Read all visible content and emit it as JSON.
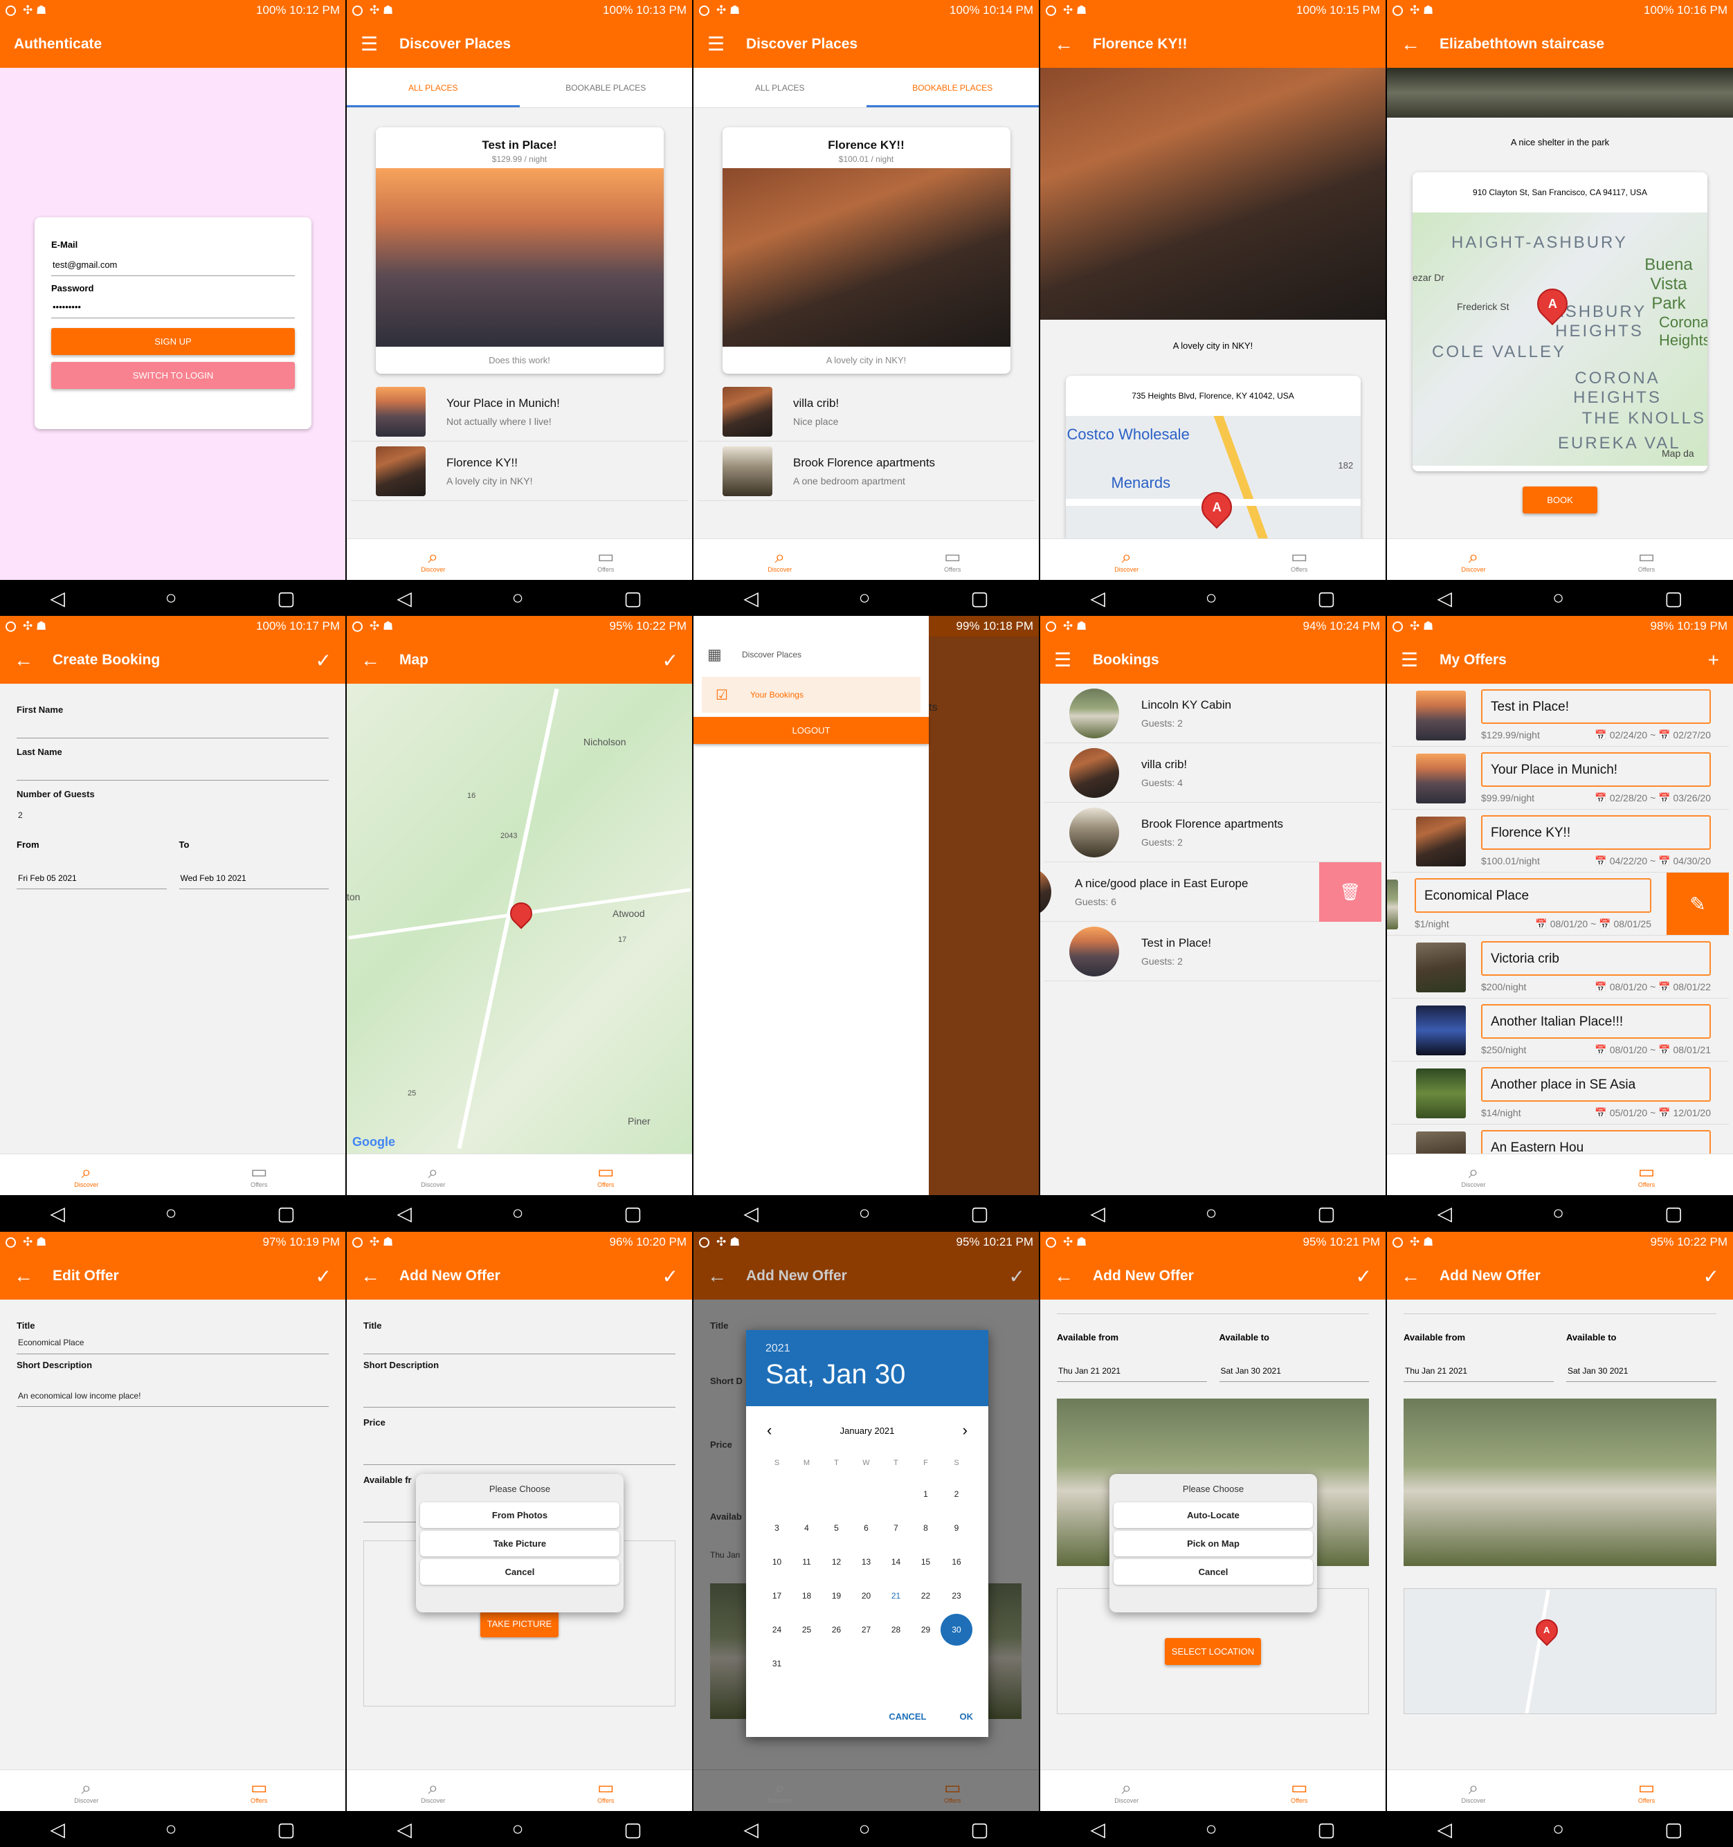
{
  "status": {
    "p1": "100%  10:12 PM",
    "p2": "100%  10:13 PM",
    "p3": "100%  10:14 PM",
    "p4": "100%  10:15 PM",
    "p5": "100%  10:16 PM",
    "p6": "100%  10:17 PM",
    "p7": "95%  10:22 PM",
    "p8": "99%  10:18 PM",
    "p9": "94%  10:24 PM",
    "p10": "98%  10:19 PM",
    "p11": "97%  10:19 PM",
    "p12": "96%  10:20 PM",
    "p13": "95%  10:21 PM",
    "p14": "95%  10:21 PM",
    "p15": "95%  10:22 PM"
  },
  "tabbar": {
    "discover": "Discover",
    "offers": "Offers"
  },
  "auth": {
    "title": "Authenticate",
    "email_label": "E-Mail",
    "email_value": "test@gmail.com",
    "password_label": "Password",
    "password_value": "•••••••••",
    "signup": "SIGN UP",
    "switch": "SWITCH TO LOGIN"
  },
  "discover": {
    "title": "Discover Places",
    "tab_all": "ALL PLACES",
    "tab_bookable": "BOOKABLE PLACES",
    "all_featured": {
      "title": "Test in Place!",
      "price": "$129.99 / night",
      "desc": "Does this work!"
    },
    "all_list": [
      {
        "title": "Your Place in Munich!",
        "desc": "Not actually where I live!"
      },
      {
        "title": "Florence KY!!",
        "desc": "A lovely city in NKY!"
      }
    ],
    "bookable_featured": {
      "title": "Florence KY!!",
      "price": "$100.01 / night",
      "desc": "A lovely city in NKY!"
    },
    "bookable_list": [
      {
        "title": "villa crib!",
        "desc": "Nice place"
      },
      {
        "title": "Brook Florence apartments",
        "desc": "A one bedroom apartment"
      }
    ]
  },
  "detail1": {
    "title": "Florence KY!!",
    "desc": "A lovely city in NKY!",
    "address": "735 Heights Blvd, Florence, KY 41042, USA",
    "map_labels": [
      "Costco Wholesale",
      "Menards",
      "182"
    ]
  },
  "detail2": {
    "title": "Elizabethtown staircase",
    "desc": "A nice shelter in the park",
    "address": "910 Clayton St, San Francisco, CA 94117, USA",
    "map_labels": [
      "HAIGHT-ASHBURY",
      "Buena Vista Park",
      "Frederick St",
      "ASHBURY HEIGHTS",
      "COLE VALLEY",
      "Corona Heights",
      "CORONA HEIGHTS",
      "THE KNOLLS",
      "EUREKA VAL",
      "Map da",
      "ezar Dr"
    ],
    "book": "BOOK"
  },
  "booking": {
    "title": "Create  Booking",
    "first_name": "First Name",
    "last_name": "Last Name",
    "guests_label": "Number of Guests",
    "guests_value": "2",
    "from_label": "From",
    "from_value": "Fri Feb 05 2021",
    "to_label": "To",
    "to_value": "Wed Feb 10 2021"
  },
  "mappage": {
    "title": "Map",
    "labels": [
      "Nicholson",
      "16",
      "2043",
      "ton",
      "Atwood",
      "17",
      "25",
      "Piner",
      "Google"
    ]
  },
  "menu": {
    "discover": "Discover Places",
    "bookings": "Your Bookings",
    "logout": "LOGOUT",
    "behind": "ts"
  },
  "bookings": {
    "title": "Bookings",
    "items": [
      {
        "title": "Lincoln KY Cabin",
        "guests": "Guests: 2"
      },
      {
        "title": "villa crib!",
        "guests": "Guests: 4"
      },
      {
        "title": "Brook Florence apartments",
        "guests": "Guests: 2"
      },
      {
        "title": "A nice/good place in East Europe",
        "guests": "Guests: 6"
      },
      {
        "title": "Test in Place!",
        "guests": "Guests: 2"
      }
    ]
  },
  "offers": {
    "title": "My Offers",
    "items": [
      {
        "title": "Test in Place!",
        "price": "$129.99/night",
        "from": "02/24/20",
        "to": "02/27/20"
      },
      {
        "title": "Your Place in Munich!",
        "price": "$99.99/night",
        "from": "02/28/20",
        "to": "03/26/20"
      },
      {
        "title": "Florence KY!!",
        "price": "$100.01/night",
        "from": "04/22/20",
        "to": "04/30/20"
      },
      {
        "title": "Economical Place",
        "price": "$1/night",
        "from": "08/01/20",
        "to": "08/01/25"
      },
      {
        "title": "Victoria crib",
        "price": "$200/night",
        "from": "08/01/20",
        "to": "08/01/22"
      },
      {
        "title": "Another Italian Place!!!",
        "price": "$250/night",
        "from": "08/01/20",
        "to": "08/01/21"
      },
      {
        "title": "Another place in SE Asia",
        "price": "$14/night",
        "from": "05/01/20",
        "to": "12/01/20"
      },
      {
        "title": "An Eastern Hou",
        "price": "",
        "from": "",
        "to": ""
      }
    ]
  },
  "edit": {
    "title": "Edit Offer",
    "title_label": "Title",
    "title_value": "Economical Place",
    "desc_label": "Short Description",
    "desc_value": "An economical low income place!"
  },
  "add": {
    "title": "Add New Offer",
    "title_label": "Title",
    "desc_label": "Short Description",
    "price_label": "Price",
    "avail_label": "Available fr",
    "choose": "Please Choose",
    "from_photos": "From Photos",
    "take_picture": "Take Picture",
    "cancel": "Cancel",
    "take_btn": "TAKE PICTURE",
    "avail_from": "Available from",
    "avail_to": "Available to",
    "from_value": "Thu Jan 21 2021",
    "to_value": "Sat Jan 30 2021",
    "auto_locate": "Auto-Locate",
    "pick_map": "Pick on Map",
    "select_loc": "SELECT LOCATION",
    "behind_short": "Short D",
    "behind_avail": "Availab",
    "behind_from": "Thu Jan"
  },
  "calendar": {
    "year": "2021",
    "date": "Sat, Jan 30",
    "month": "January 2021",
    "weekdays": [
      "S",
      "M",
      "T",
      "W",
      "T",
      "F",
      "S"
    ],
    "cancel": "CANCEL",
    "ok": "OK"
  },
  "colors": {
    "accent": "#ff6d00",
    "blue": "#1e6fb8",
    "delete": "#f8828f"
  }
}
